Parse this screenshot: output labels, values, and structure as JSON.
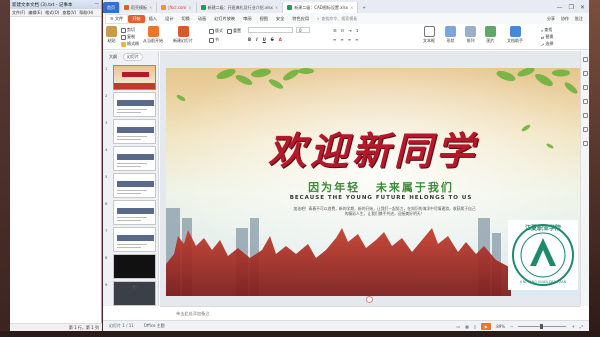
{
  "notepad": {
    "title": "新建文本文档 (3).txt - 记事本",
    "menu": [
      "文件(F)",
      "编辑(E)",
      "格式(O)",
      "查看(V)",
      "帮助(H)"
    ],
    "status": "第 1 行，第 1 列"
  },
  "tabs": [
    {
      "label": "首页",
      "kind": "home"
    },
    {
      "label": "稻壳模板",
      "kind": "normal"
    },
    {
      "label": "jfkcl.com",
      "kind": "normal"
    },
    {
      "label": "新建二级：开班典礼及行业介绍.xlsx",
      "kind": "normal"
    },
    {
      "label": "新建二级：CAD图标设置.xlsx",
      "kind": "active"
    }
  ],
  "window_controls": {
    "min": "—",
    "max": "❐",
    "close": "✕"
  },
  "menubar": {
    "file": "≡ 文件",
    "items": [
      "开始",
      "插入",
      "设计",
      "切换",
      "动画",
      "幻灯片放映",
      "审阅",
      "视图",
      "安全",
      "特色应用"
    ],
    "search": "查找命令、搜索模板",
    "right": [
      "分享",
      "协作",
      "批注"
    ]
  },
  "ribbon": {
    "paste": "粘贴",
    "cut": "剪切",
    "copy": "复制",
    "format_painter": "格式刷",
    "from_current": "从当前开始",
    "new_slide": "新建幻灯片",
    "layout": "版式",
    "section": "节",
    "reset": "重置",
    "font_size": "0",
    "text_box": "文本框",
    "shapes": "形状",
    "arrange": "排列",
    "picture": "图片",
    "text_tools": "文档助手",
    "find": "查找",
    "replace": "替换",
    "select": "选择"
  },
  "panel": {
    "tabs": [
      "大纲",
      "幻灯片"
    ],
    "slide_count": 9,
    "add": "+"
  },
  "slide": {
    "title": "欢迎新同学",
    "subtitle_left": "因为年轻",
    "subtitle_right": "未来属于我们",
    "english": "BECAUSE THE YOUNG FUTURE HELONGS TO US",
    "body": "加油吧！青春不可以浪费，新的学期，新的开始，让我们一起努力，在知识的海洋中尽情遨游，收获属于自己的精彩人生。让我们携手共进，迎接美好明天！",
    "logo_text": "JI NI YANG GUAN DEF YUAN",
    "logo_cn": "江夏职业学院"
  },
  "notes_placeholder": "单击此处添加备注",
  "status": {
    "slide_info": "幻灯片 1 / 11",
    "theme": "Office 主题",
    "zoom": "89%"
  },
  "colors": {
    "brand": "#2f6fd6",
    "accent": "#e85d2a",
    "title_red": "#b3192b",
    "subtitle_green": "#3d8a3a"
  }
}
